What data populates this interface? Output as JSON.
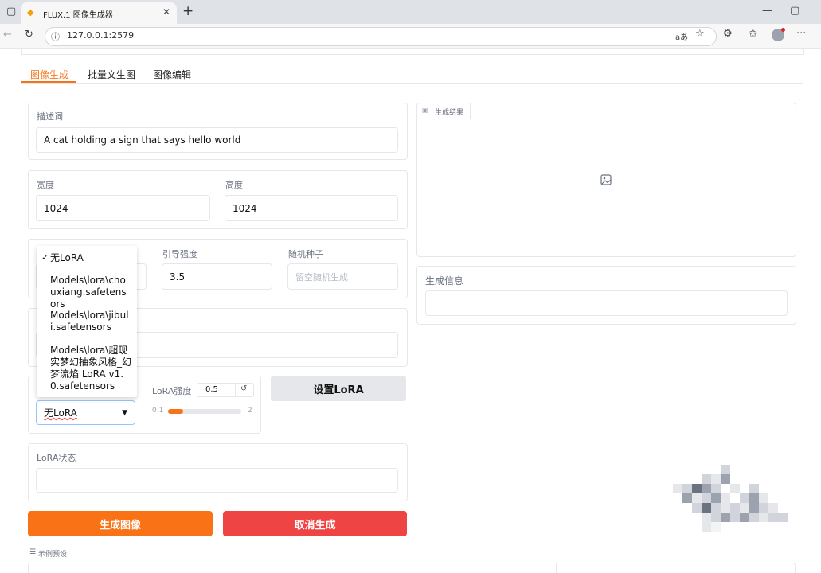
{
  "browser": {
    "tab_title": "FLUX.1 图像生成器",
    "url": "127.0.0.1:2579"
  },
  "tabs": [
    {
      "label": "图像生成",
      "active": true
    },
    {
      "label": "批量文生图",
      "active": false
    },
    {
      "label": "图像编辑",
      "active": false
    }
  ],
  "prompt": {
    "label": "描述词",
    "value": "A cat holding a sign that says hello world"
  },
  "width": {
    "label": "宽度",
    "value": "1024"
  },
  "height": {
    "label": "高度",
    "value": "1024"
  },
  "guidance": {
    "label": "引导强度",
    "value": "3.5"
  },
  "seed": {
    "label": "随机种子",
    "placeholder": "留空随机生成"
  },
  "lora": {
    "options": [
      "无LoRA",
      "Models\\lora\\chouxiang.safetensors",
      "Models\\lora\\jibuli.safetensors",
      "Models\\lora\\超现实梦幻抽象风格_幻梦流焰 LoRA v1.0.safetensors"
    ],
    "selected_mark": "✓",
    "selected": "无LoRA",
    "strength_label": "LoRA强度",
    "strength_value": "0.5",
    "strength_min": "0.1",
    "strength_max": "2",
    "strength_fraction": 0.21,
    "set_button": "设置LoRA",
    "status_label": "LoRA状态",
    "status_value": ""
  },
  "result": {
    "label": "生成结果",
    "info_label": "生成信息"
  },
  "actions": {
    "generate": "生成图像",
    "cancel": "取消生成"
  },
  "examples_label": "示例预设",
  "colors": {
    "accent": "#f97316",
    "danger": "#ef4444",
    "neutral_button": "#e5e7eb"
  }
}
